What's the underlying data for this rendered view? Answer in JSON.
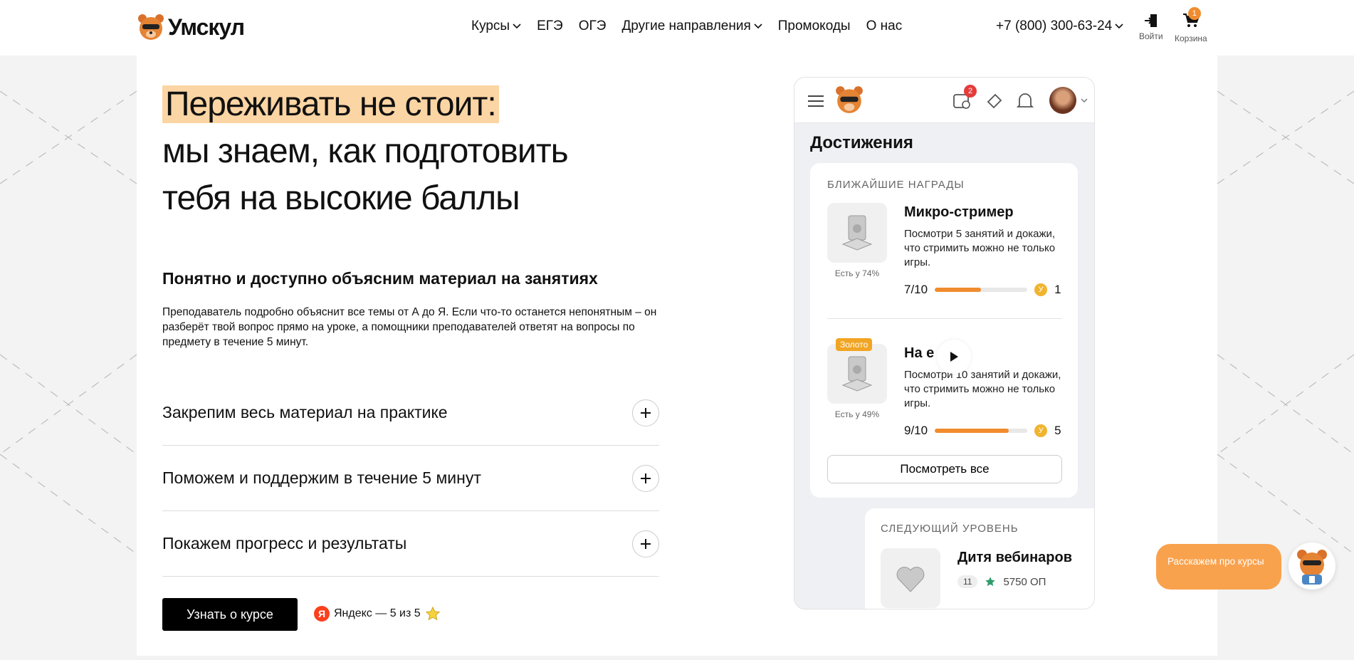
{
  "header": {
    "logo_text": "Умскул",
    "nav": [
      "Курсы",
      "ЕГЭ",
      "ОГЭ",
      "Другие направления",
      "Промокоды",
      "О нас"
    ],
    "phone": "+7 (800) 300-63-24",
    "login_label": "Войти",
    "cart_label": "Корзина",
    "cart_count": "1"
  },
  "hero": {
    "title_highlight": "Переживать не стоит:",
    "title_line2": "мы знаем, как подготовить",
    "title_line3": "тебя на высокие баллы",
    "subheading": "Понятно и доступно объясним материал на занятиях",
    "subtext": "Преподаватель подробно объяснит все темы от А до Я. Если что-то останется непонятным – он разберёт твой вопрос прямо на уроке, а помощники преподавателей ответят на вопросы по предмету в течение 5 минут.",
    "accordion": [
      "Закрепим весь материал на практике",
      "Поможем и поддержим в течение 5 минут",
      "Покажем  прогресс и результаты"
    ],
    "cta_label": "Узнать о курсе",
    "rating_text": "Яндекс — 5 из 5"
  },
  "mockup": {
    "notif_count": "2",
    "heading": "Достижения",
    "section_label": "БЛИЖАЙШИЕ НАГРАДЫ",
    "awards": [
      {
        "name": "Микро-стример",
        "desc": "Посмотри 5 занятий и докажи, что стримить можно не только игры.",
        "pct": "Есть у 74%",
        "progress_text": "7/10",
        "progress": 0.5,
        "reward": "1",
        "tag": ""
      },
      {
        "name": "На    е",
        "desc": "Посмотри 10 занятий и докажи, что стримить можно не только игры.",
        "pct": "Есть у 49%",
        "progress_text": "9/10",
        "progress": 0.8,
        "reward": "5",
        "tag": "Золото"
      }
    ],
    "see_all_label": "Посмотреть все",
    "next_label": "СЛЕДУЮЩИЙ УРОВЕНЬ",
    "next_name": "Дитя вебинаров",
    "next_level": "11",
    "next_points": "5750 ОП"
  },
  "chat": {
    "bubble_text": "Расскажем про курсы"
  },
  "colors": {
    "accent": "#f08c2e",
    "highlight": "#fcd5a4",
    "chat": "#f9a24d"
  }
}
